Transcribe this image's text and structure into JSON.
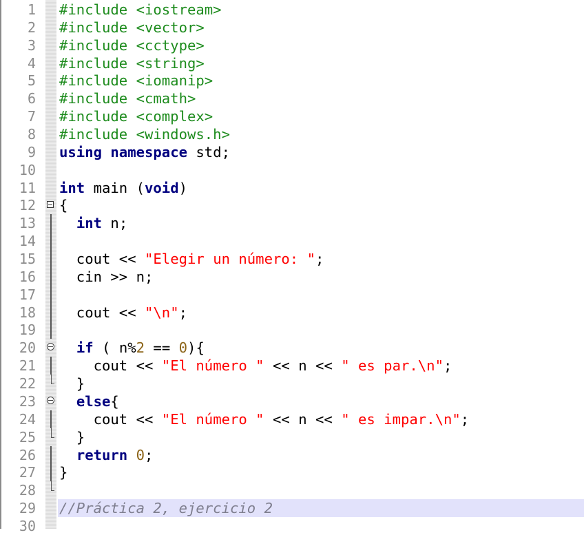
{
  "editor": {
    "highlighted_line": 29,
    "folds": {
      "12": "box",
      "20": "circle",
      "23": "circle"
    },
    "lines": [
      [
        [
          "pp",
          "#include <iostream>"
        ]
      ],
      [
        [
          "pp",
          "#include <vector>"
        ]
      ],
      [
        [
          "pp",
          "#include <cctype>"
        ]
      ],
      [
        [
          "pp",
          "#include <string>"
        ]
      ],
      [
        [
          "pp",
          "#include <iomanip>"
        ]
      ],
      [
        [
          "pp",
          "#include <cmath>"
        ]
      ],
      [
        [
          "pp",
          "#include <complex>"
        ]
      ],
      [
        [
          "pp",
          "#include <windows.h>"
        ]
      ],
      [
        [
          "kw",
          "using"
        ],
        [
          "op",
          " "
        ],
        [
          "kw",
          "namespace"
        ],
        [
          "op",
          " std;"
        ]
      ],
      [],
      [
        [
          "kw",
          "int"
        ],
        [
          "op",
          " main ("
        ],
        [
          "kw",
          "void"
        ],
        [
          "op",
          ")"
        ]
      ],
      [
        [
          "op",
          "{"
        ]
      ],
      [
        [
          "op",
          "  "
        ],
        [
          "kw",
          "int"
        ],
        [
          "op",
          " n;"
        ]
      ],
      [],
      [
        [
          "op",
          "  cout << "
        ],
        [
          "str",
          "\"Elegir un número: \""
        ],
        [
          "op",
          ";"
        ]
      ],
      [
        [
          "op",
          "  cin >> n;"
        ]
      ],
      [],
      [
        [
          "op",
          "  cout << "
        ],
        [
          "str",
          "\"\\n\""
        ],
        [
          "op",
          ";"
        ]
      ],
      [],
      [
        [
          "op",
          "  "
        ],
        [
          "kw",
          "if"
        ],
        [
          "op",
          " ( n%"
        ],
        [
          "num",
          "2"
        ],
        [
          "op",
          " == "
        ],
        [
          "num",
          "0"
        ],
        [
          "op",
          "){"
        ]
      ],
      [
        [
          "op",
          "    cout << "
        ],
        [
          "str",
          "\"El número \""
        ],
        [
          "op",
          " << n << "
        ],
        [
          "str",
          "\" es par.\\n\""
        ],
        [
          "op",
          ";"
        ]
      ],
      [
        [
          "op",
          "  }"
        ]
      ],
      [
        [
          "op",
          "  "
        ],
        [
          "kw",
          "else"
        ],
        [
          "op",
          "{"
        ]
      ],
      [
        [
          "op",
          "    cout << "
        ],
        [
          "str",
          "\"El número \""
        ],
        [
          "op",
          " << n << "
        ],
        [
          "str",
          "\" es impar.\\n\""
        ],
        [
          "op",
          ";"
        ]
      ],
      [
        [
          "op",
          "  }"
        ]
      ],
      [
        [
          "op",
          "  "
        ],
        [
          "kw",
          "return"
        ],
        [
          "op",
          " "
        ],
        [
          "num",
          "0"
        ],
        [
          "op",
          ";"
        ]
      ],
      [
        [
          "op",
          "}"
        ]
      ],
      [],
      [
        [
          "cm",
          "//Práctica 2, ejercicio 2"
        ]
      ],
      []
    ]
  }
}
